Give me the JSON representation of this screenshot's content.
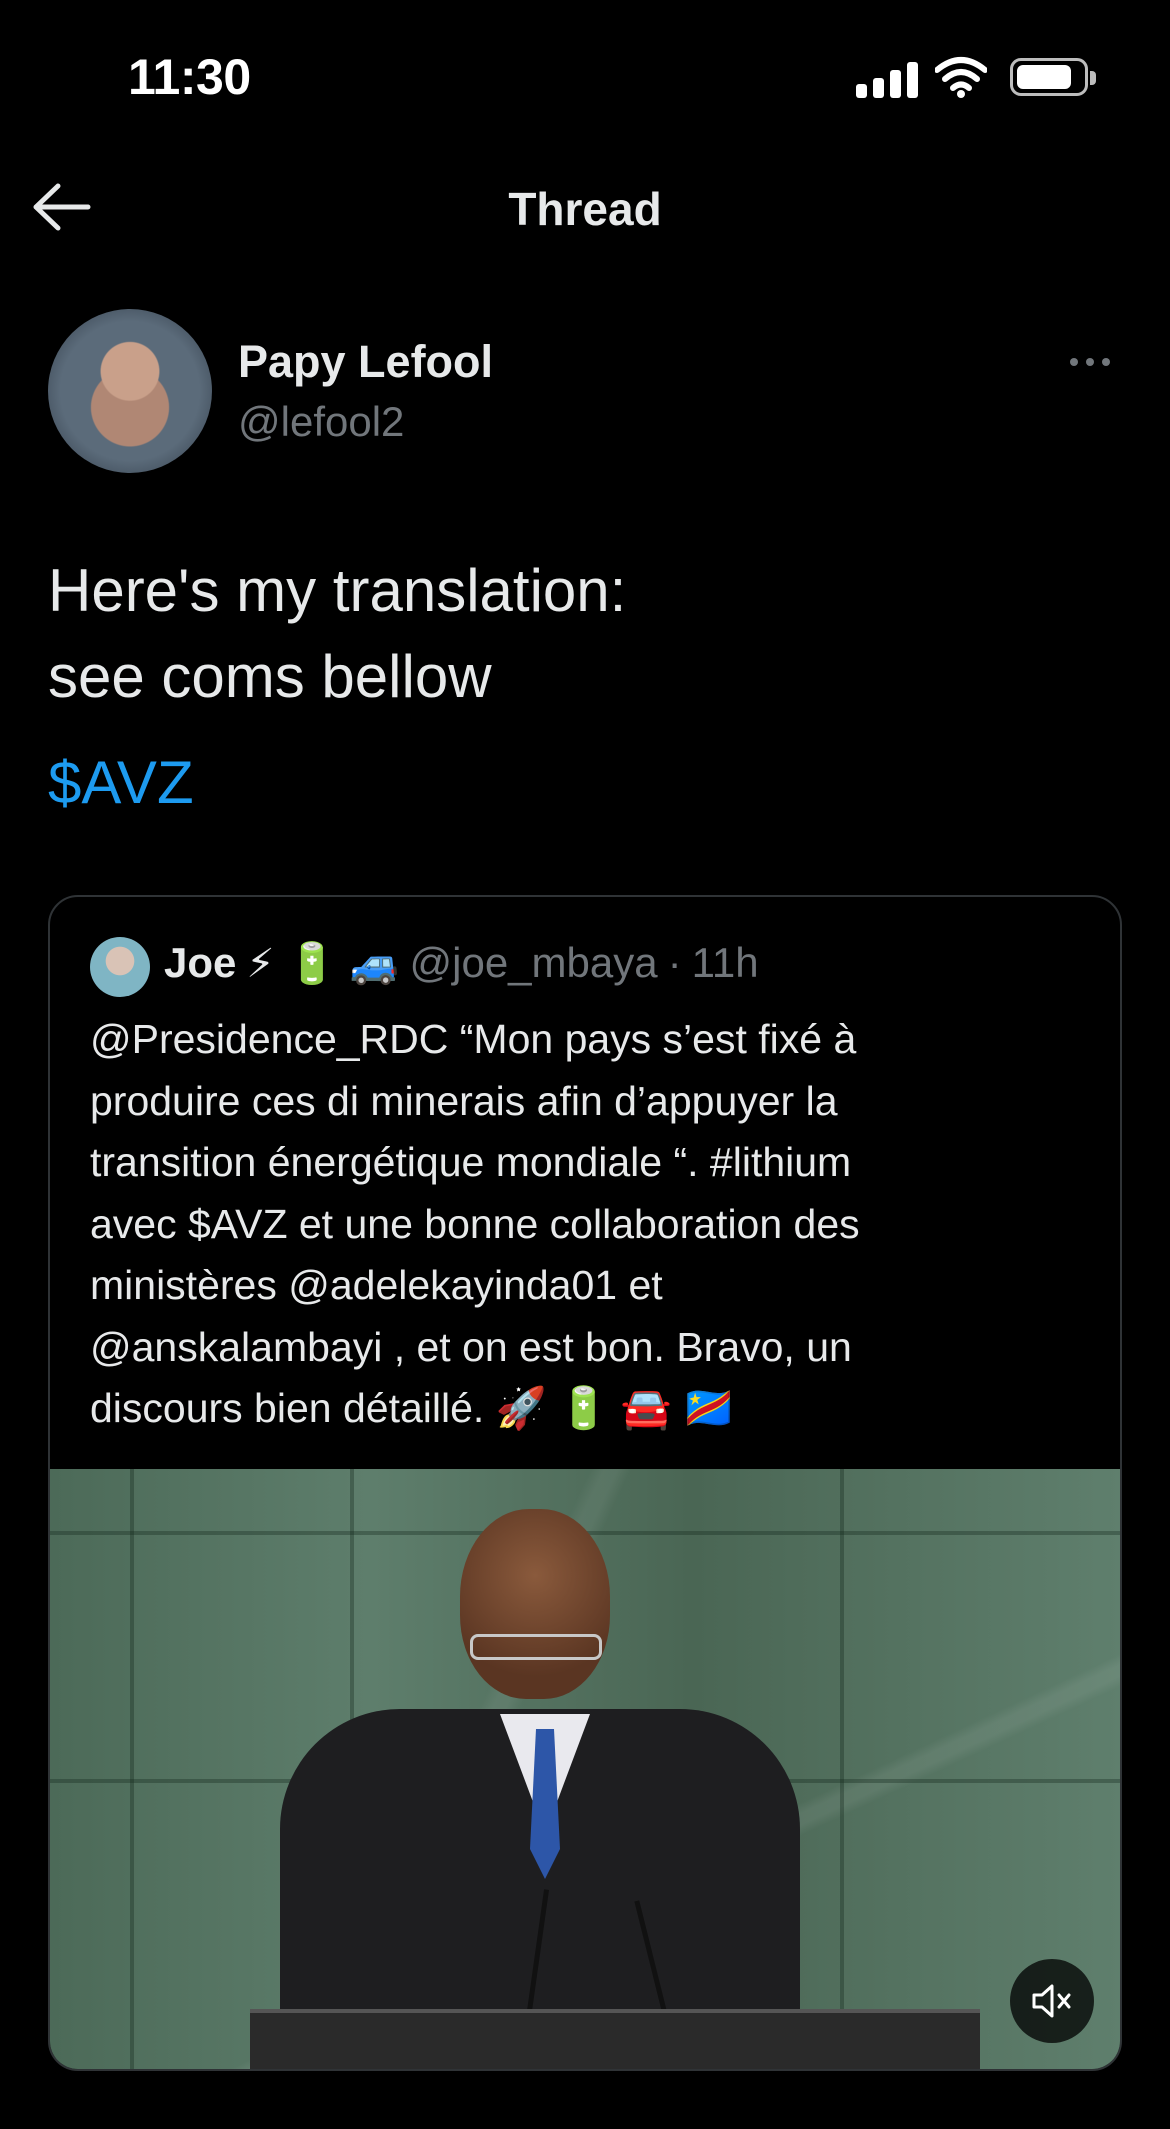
{
  "status_bar": {
    "time": "11:30"
  },
  "header": {
    "title": "Thread"
  },
  "tweet": {
    "author_name": "Papy Lefool",
    "author_handle": "@lefool2",
    "text": "Here's my translation:\nsee coms bellow",
    "cashtag": "$AVZ"
  },
  "quote": {
    "name": "Joe",
    "emojis": "⚡ 🔋  🚙",
    "handle": "@joe_mbaya",
    "separator": "·",
    "time": "11h",
    "text": "@Presidence_RDC “Mon pays s’est fixé à\nproduire ces di minerais afin d’appuyer la\ntransition énergétique mondiale “. #lithium\navec $AVZ et une bonne collaboration des\nministères @adelekayinda01  et\n@anskalambayi , et on est bon. Bravo, un\ndiscours bien détaillé. 🚀 🔋 🚘 🇨🇩"
  }
}
